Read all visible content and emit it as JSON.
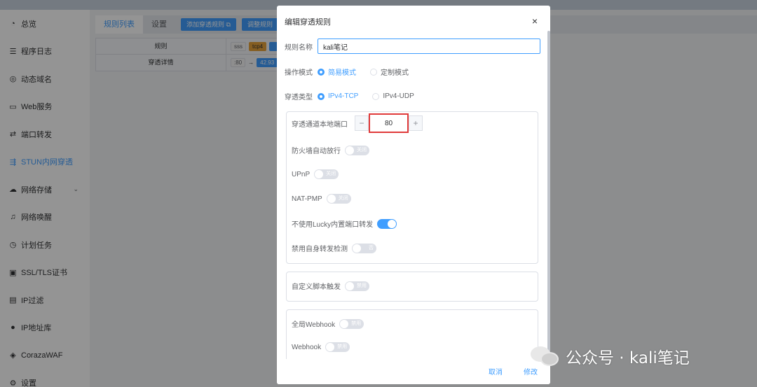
{
  "sidebar": {
    "items": [
      {
        "label": "总览",
        "icon": "dashboard-icon",
        "glyph": "◔"
      },
      {
        "label": "程序日志",
        "icon": "log-icon",
        "glyph": "☰"
      },
      {
        "label": "动态域名",
        "icon": "ddns-icon",
        "glyph": "◎"
      },
      {
        "label": "Web服务",
        "icon": "web-service-icon",
        "glyph": "▭"
      },
      {
        "label": "端口转发",
        "icon": "port-forward-icon",
        "glyph": "⇄"
      },
      {
        "label": "STUN内网穿透",
        "icon": "stun-icon",
        "glyph": "⇶"
      },
      {
        "label": "网络存储",
        "icon": "cloud-storage-icon",
        "glyph": "☁"
      },
      {
        "label": "网络唤醒",
        "icon": "bell-icon",
        "glyph": "♫"
      },
      {
        "label": "计划任务",
        "icon": "clock-icon",
        "glyph": "◷"
      },
      {
        "label": "SSL/TLS证书",
        "icon": "certificate-icon",
        "glyph": "▣"
      },
      {
        "label": "IP过滤",
        "icon": "filter-icon",
        "glyph": "▤"
      },
      {
        "label": "IP地址库",
        "icon": "user-icon",
        "glyph": "●"
      },
      {
        "label": "CorazaWAF",
        "icon": "shield-icon",
        "glyph": "◈"
      },
      {
        "label": "设置",
        "icon": "gear-icon",
        "glyph": "⚙"
      }
    ],
    "active_index": 5
  },
  "main": {
    "tabs": [
      "规则列表",
      "设置"
    ],
    "buttons": [
      "添加穿透规则 ⧉",
      "调整规则"
    ],
    "table": {
      "row1": {
        "header": "规则",
        "tags": [
          "sss",
          "tcp4"
        ]
      },
      "row2": {
        "header": "穿透详情",
        "port": ":80",
        "arrow": "→",
        "ip": "42.93"
      }
    }
  },
  "dialog": {
    "title": "编辑穿透规则",
    "close": "×",
    "rule_name_label": "规则名称",
    "rule_name_value": "kali笔记",
    "mode_label": "操作模式",
    "mode_options": [
      "简易模式",
      "定制模式"
    ],
    "type_label": "穿透类型",
    "type_options": [
      "IPv4-TCP",
      "IPv4-UDP"
    ],
    "port_label": "穿透通道本地端口",
    "port_value": "80",
    "minus": "−",
    "plus": "+",
    "firewall_label": "防火墙自动放行",
    "firewall_state": "关闭",
    "upnp_label": "UPnP",
    "upnp_state": "关闭",
    "natpmp_label": "NAT-PMP",
    "natpmp_state": "关闭",
    "lucky_label": "不使用Lucky内置端口转发",
    "selfcheck_label": "禁用自身转发检测",
    "selfcheck_state": "否",
    "custom_script_label": "自定义脚本触发",
    "custom_script_state": "禁用",
    "global_webhook_label": "全局Webhook",
    "global_webhook_state": "禁用",
    "webhook_label": "Webhook",
    "webhook_state": "禁用",
    "cancel": "取消",
    "confirm": "修改"
  },
  "watermark": {
    "text": "公众号 · kali笔记"
  },
  "colors": {
    "accent": "#409eff",
    "highlight": "#e03a3a"
  }
}
